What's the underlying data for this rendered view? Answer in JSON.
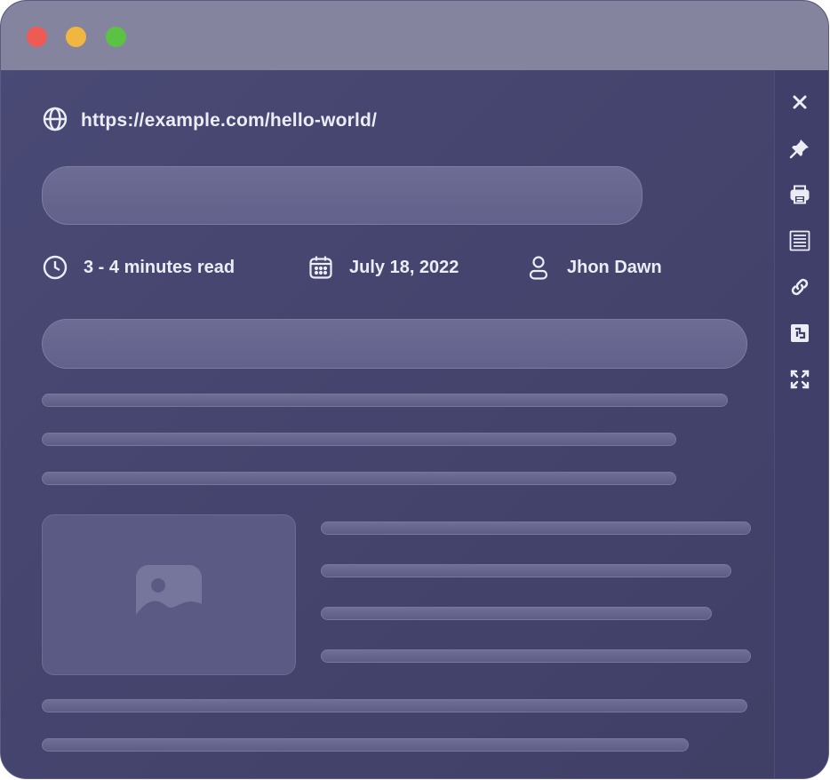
{
  "address": {
    "url": "https://example.com/hello-world/",
    "icon": "globe-icon"
  },
  "meta": {
    "read_time": "3 - 4 minutes read",
    "date": "July 18, 2022",
    "author": "Jhon Dawn"
  },
  "window_controls": [
    "close",
    "minimize",
    "maximize"
  ],
  "toolbar": {
    "items": [
      "close-icon",
      "pin-icon",
      "print-icon",
      "list-view-icon",
      "link-icon",
      "translate-icon",
      "fullscreen-icon"
    ]
  },
  "colors": {
    "titlebar": "#85849f",
    "background": "#45456f",
    "text": "#ececf5",
    "red": "#ee5b54",
    "yellow": "#f0b63f",
    "green": "#5cc244"
  }
}
